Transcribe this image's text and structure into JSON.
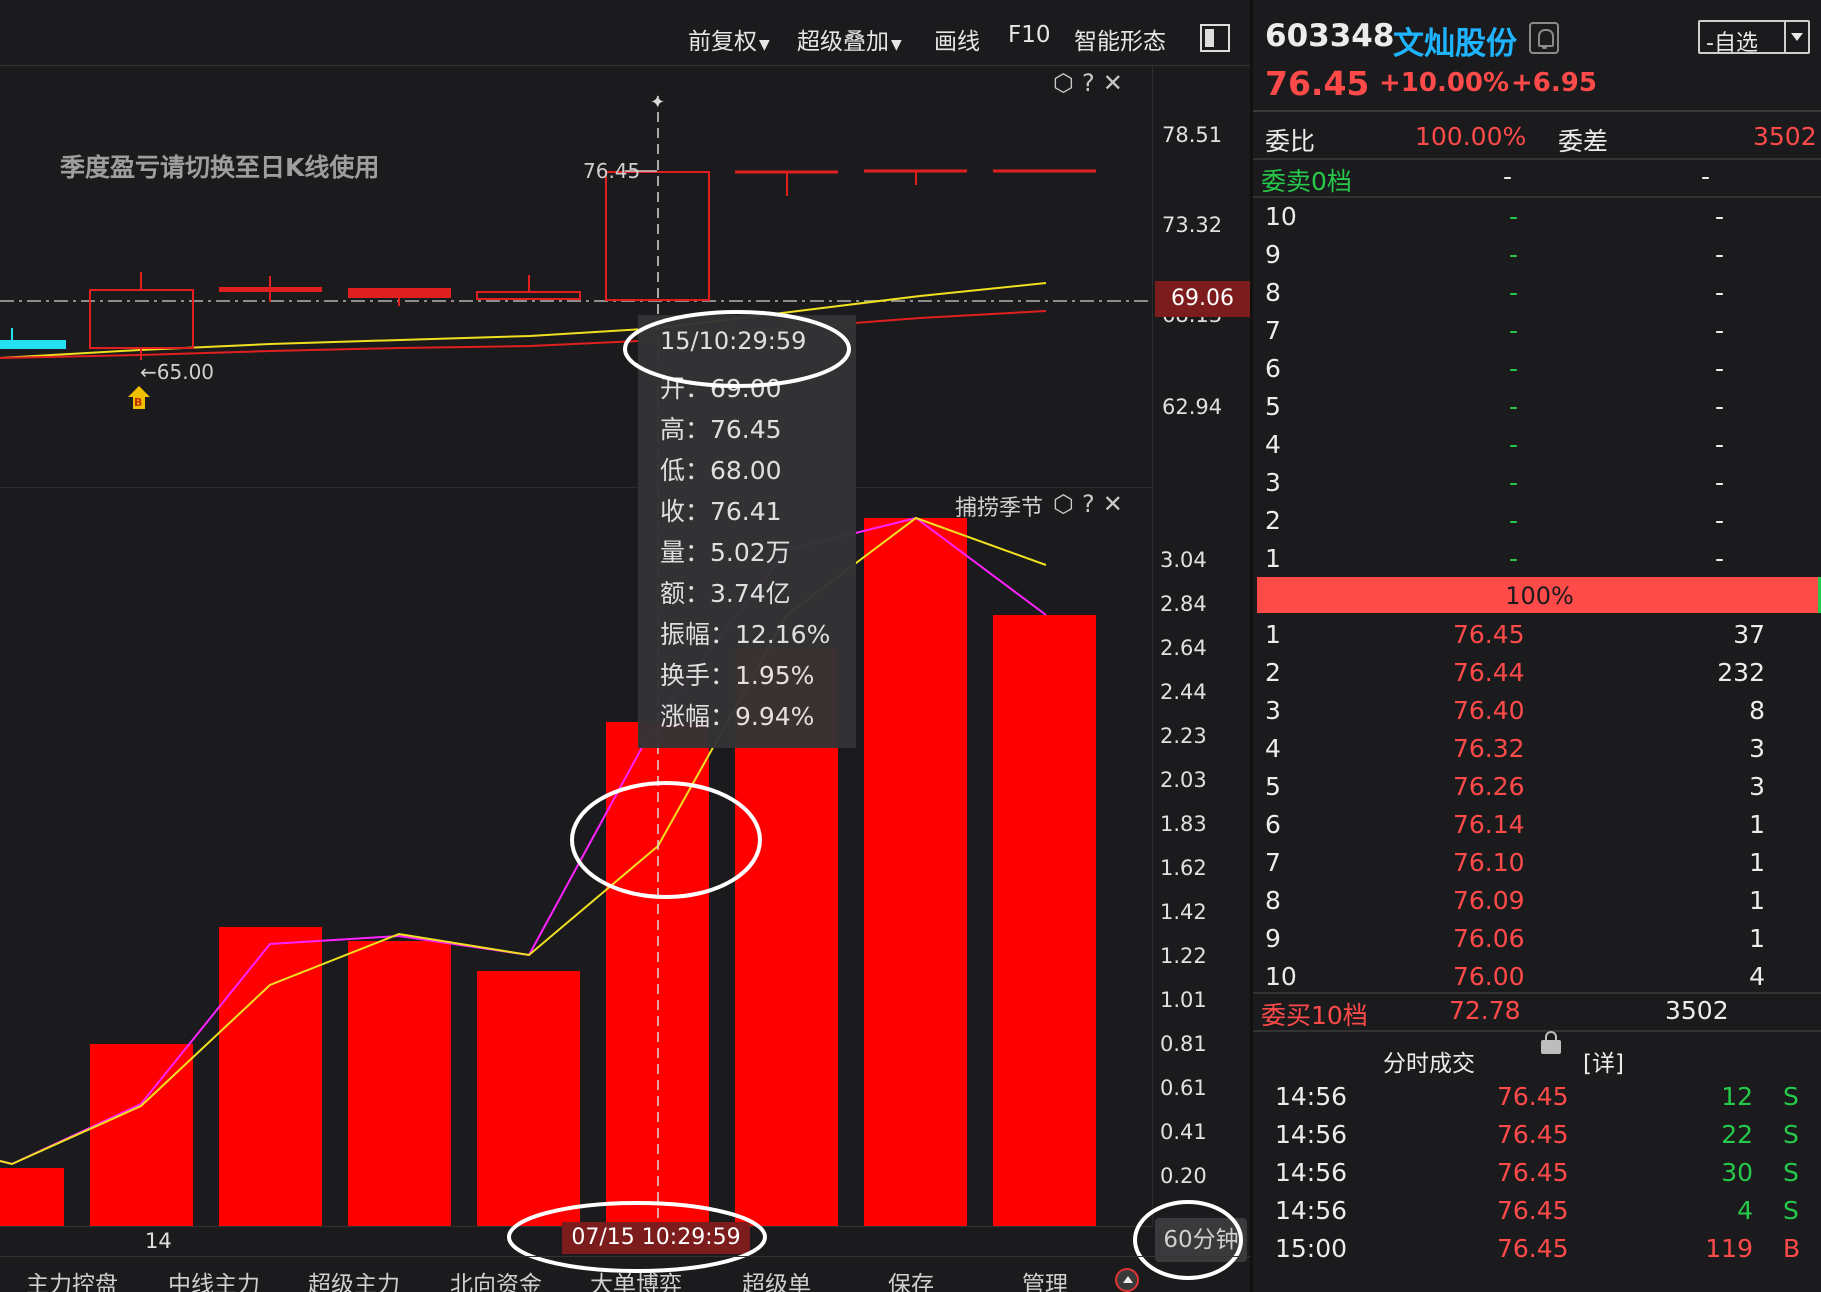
{
  "toolbar": {
    "items": [
      "前复权",
      "超级叠加",
      "画线",
      "F10",
      "智能形态"
    ]
  },
  "kline_pane": {
    "notice": "季度盈亏请切换至日K线使用",
    "y_axis": [
      "78.51",
      "73.32",
      "68.13",
      "62.94"
    ],
    "current_price_tag": "69.06",
    "high_label": "76.45",
    "low_label": "←65.00",
    "buy_marker": "B"
  },
  "indicator_pane": {
    "title": "捕捞季节",
    "y_axis": [
      "3.04",
      "2.84",
      "2.64",
      "2.44",
      "2.23",
      "2.03",
      "1.83",
      "1.62",
      "1.42",
      "1.22",
      "1.01",
      "0.81",
      "0.61",
      "0.41",
      "0.20"
    ]
  },
  "tooltip": {
    "time": "15/10:29:59",
    "rows": [
      "开：69.00",
      "高：76.45",
      "低：68.00",
      "收：76.41",
      "量：5.02万",
      "额：3.74亿",
      "振幅：12.16%",
      "换手：1.95%",
      "涨幅：9.94%"
    ]
  },
  "x_axis": {
    "tick": "14",
    "cursor_date": "07/15 10:29:59",
    "period": "60分钟"
  },
  "bottom_tabs": [
    "主力控盘",
    "中线主力",
    "超级主力",
    "北向资金",
    "大单博弈",
    "超级单",
    "保存",
    "管理"
  ],
  "stock": {
    "code": "603348",
    "name": "文灿股份",
    "price": "76.45",
    "pct_change": "+10.00%",
    "abs_change": "+6.95",
    "watch_label": "-自选"
  },
  "order_book": {
    "ratio_label": "委比",
    "ratio_value": "100.00%",
    "diff_label": "委差",
    "diff_value": "3502",
    "sell_total_label": "委卖0档",
    "sell_total_price": "-",
    "sell_total_volume": "-",
    "sell_levels": [
      {
        "level": "10",
        "price": "-",
        "volume": "-"
      },
      {
        "level": "9",
        "price": "-",
        "volume": "-"
      },
      {
        "level": "8",
        "price": "-",
        "volume": "-"
      },
      {
        "level": "7",
        "price": "-",
        "volume": "-"
      },
      {
        "level": "6",
        "price": "-",
        "volume": "-"
      },
      {
        "level": "5",
        "price": "-",
        "volume": "-"
      },
      {
        "level": "4",
        "price": "-",
        "volume": "-"
      },
      {
        "level": "3",
        "price": "-",
        "volume": "-"
      },
      {
        "level": "2",
        "price": "-",
        "volume": "-"
      },
      {
        "level": "1",
        "price": "-",
        "volume": "-"
      }
    ],
    "bar_label": "100%",
    "buy_levels": [
      {
        "level": "1",
        "price": "76.45",
        "volume": "37"
      },
      {
        "level": "2",
        "price": "76.44",
        "volume": "232"
      },
      {
        "level": "3",
        "price": "76.40",
        "volume": "8"
      },
      {
        "level": "4",
        "price": "76.32",
        "volume": "3"
      },
      {
        "level": "5",
        "price": "76.26",
        "volume": "3"
      },
      {
        "level": "6",
        "price": "76.14",
        "volume": "1"
      },
      {
        "level": "7",
        "price": "76.10",
        "volume": "1"
      },
      {
        "level": "8",
        "price": "76.09",
        "volume": "1"
      },
      {
        "level": "9",
        "price": "76.06",
        "volume": "1"
      },
      {
        "level": "10",
        "price": "76.00",
        "volume": "4"
      }
    ],
    "buy_total_label": "委买10档",
    "buy_total_price": "72.78",
    "buy_total_volume": "3502"
  },
  "trades": {
    "title": "分时成交",
    "detail": "[详]",
    "rows": [
      {
        "time": "14:56",
        "price": "76.45",
        "volume": "12",
        "side": "S"
      },
      {
        "time": "14:56",
        "price": "76.45",
        "volume": "22",
        "side": "S"
      },
      {
        "time": "14:56",
        "price": "76.45",
        "volume": "30",
        "side": "S"
      },
      {
        "time": "14:56",
        "price": "76.45",
        "volume": "4",
        "side": "S"
      },
      {
        "time": "15:00",
        "price": "76.45",
        "volume": "119",
        "side": "B"
      }
    ]
  },
  "colors": {
    "up": "#ff4a4a",
    "down": "#26c94a",
    "accent": "#1fb4ff",
    "bar": "#ff0000"
  }
}
